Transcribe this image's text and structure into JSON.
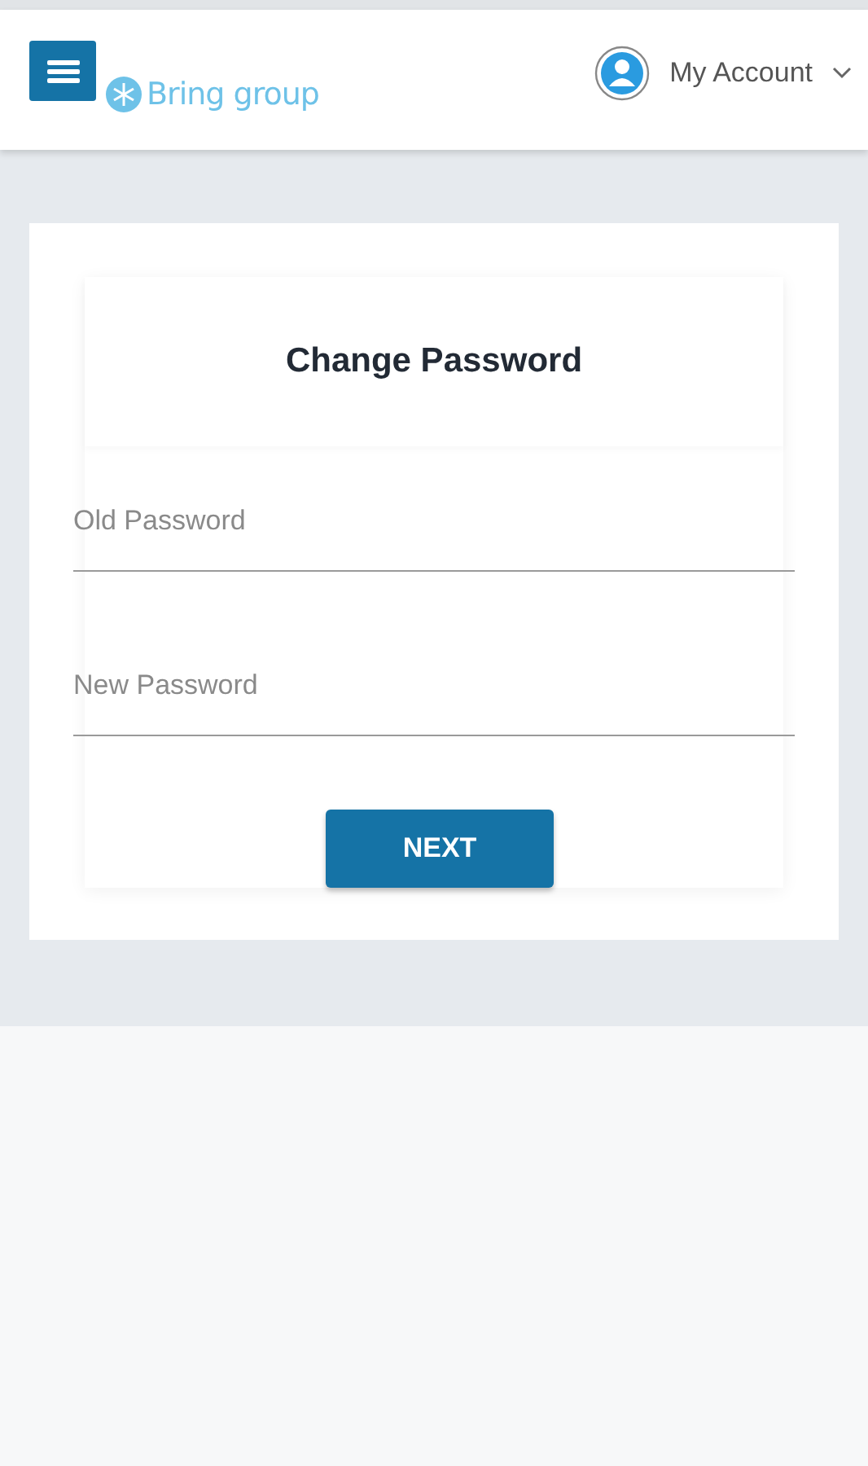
{
  "header": {
    "brand": "Bring group",
    "account": "My Account"
  },
  "form": {
    "title": "Change Password",
    "fields": [
      {
        "placeholder": "Old Password"
      },
      {
        "placeholder": "New Password"
      }
    ],
    "button": "NEXT"
  }
}
